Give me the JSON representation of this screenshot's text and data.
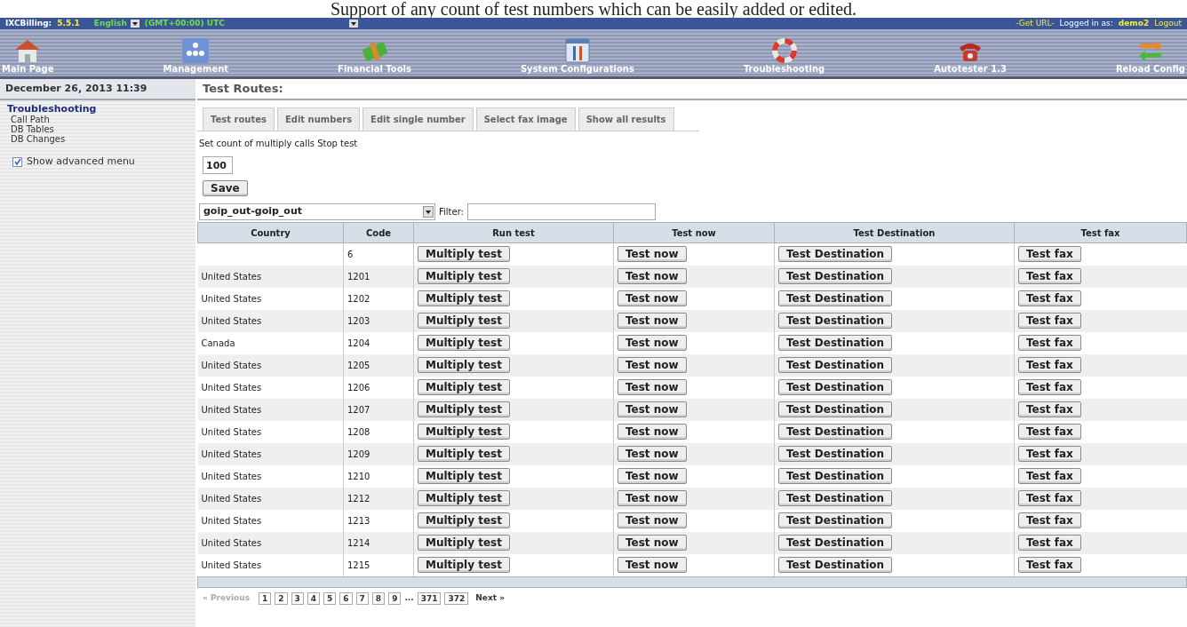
{
  "caption": "Support of any count of test numbers which can be easily added or edited.",
  "top_bar": {
    "product": "IXCBilling:",
    "version": "5.5.1",
    "language": "English",
    "timezone": "(GMT+00:00) UTC",
    "get_url": "-Get URL-",
    "logged_in_label": "Logged in as:",
    "user": "demo2",
    "logout": "Logout"
  },
  "nav": [
    {
      "label": "Main Page",
      "kind": "house"
    },
    {
      "label": "Management",
      "kind": "users"
    },
    {
      "label": "Financial Tools",
      "kind": "money"
    },
    {
      "label": "System Configurations",
      "kind": "tools"
    },
    {
      "label": "Troubleshooting",
      "kind": "lifebuoy"
    },
    {
      "label": "Autotester 1.3",
      "kind": "phone"
    },
    {
      "label": "Reload Config",
      "kind": "reload"
    }
  ],
  "sidebar": {
    "date": "December 26, 2013 11:39",
    "section": "Troubleshooting",
    "items": [
      "Call Path",
      "DB Tables",
      "DB Changes"
    ],
    "advanced": {
      "label": "Show advanced menu",
      "checked": true
    }
  },
  "content": {
    "title": "Test Routes:",
    "tabs": [
      "Test routes",
      "Edit numbers",
      "Edit single number",
      "Select fax image",
      "Show all results"
    ],
    "count_label": "Set count of multiply calls Stop test",
    "count_value": "100",
    "save": "Save",
    "route": "goip_out-goip_out",
    "filter_label": "Filter:",
    "columns": [
      "Country",
      "Code",
      "Run test",
      "Test now",
      "Test Destination",
      "Test fax"
    ],
    "rows": [
      {
        "country": "",
        "code": "6",
        "run": "Multiply test",
        "now": "Test now",
        "dest": "Test Destination",
        "fax": "Test fax"
      },
      {
        "country": "United States",
        "code": "1201",
        "run": "Multiply test",
        "now": "Test now",
        "dest": "Test Destination",
        "fax": "Test fax"
      },
      {
        "country": "United States",
        "code": "1202",
        "run": "Multiply test",
        "now": "Test now",
        "dest": "Test Destination",
        "fax": "Test fax"
      },
      {
        "country": "United States",
        "code": "1203",
        "run": "Multiply test",
        "now": "Test now",
        "dest": "Test Destination",
        "fax": "Test fax"
      },
      {
        "country": "Canada",
        "code": "1204",
        "run": "Multiply test",
        "now": "Test now",
        "dest": "Test Destination",
        "fax": "Test fax"
      },
      {
        "country": "United States",
        "code": "1205",
        "run": "Multiply test",
        "now": "Test now",
        "dest": "Test Destination",
        "fax": "Test fax"
      },
      {
        "country": "United States",
        "code": "1206",
        "run": "Multiply test",
        "now": "Test now",
        "dest": "Test Destination",
        "fax": "Test fax"
      },
      {
        "country": "United States",
        "code": "1207",
        "run": "Multiply test",
        "now": "Test now",
        "dest": "Test Destination",
        "fax": "Test fax"
      },
      {
        "country": "United States",
        "code": "1208",
        "run": "Multiply test",
        "now": "Test now",
        "dest": "Test Destination",
        "fax": "Test fax"
      },
      {
        "country": "United States",
        "code": "1209",
        "run": "Multiply test",
        "now": "Test now",
        "dest": "Test Destination",
        "fax": "Test fax"
      },
      {
        "country": "United States",
        "code": "1210",
        "run": "Multiply test",
        "now": "Test now",
        "dest": "Test Destination",
        "fax": "Test fax"
      },
      {
        "country": "United States",
        "code": "1212",
        "run": "Multiply test",
        "now": "Test now",
        "dest": "Test Destination",
        "fax": "Test fax"
      },
      {
        "country": "United States",
        "code": "1213",
        "run": "Multiply test",
        "now": "Test now",
        "dest": "Test Destination",
        "fax": "Test fax"
      },
      {
        "country": "United States",
        "code": "1214",
        "run": "Multiply test",
        "now": "Test now",
        "dest": "Test Destination",
        "fax": "Test fax"
      },
      {
        "country": "United States",
        "code": "1215",
        "run": "Multiply test",
        "now": "Test now",
        "dest": "Test Destination",
        "fax": "Test fax"
      }
    ],
    "pagination": {
      "previous": "« Previous",
      "pages": [
        "1",
        "2",
        "3",
        "4",
        "5",
        "6",
        "7",
        "8",
        "9"
      ],
      "ellipsis": "...",
      "last_pages": [
        "371",
        "372"
      ],
      "next": "Next »"
    }
  }
}
